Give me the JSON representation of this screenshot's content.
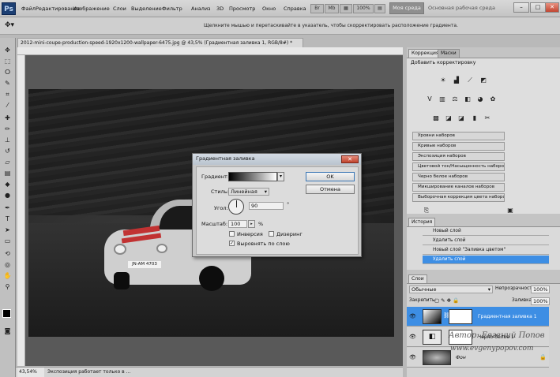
{
  "app": {
    "logo": "Ps"
  },
  "menu": [
    "Файл",
    "Редактирование",
    "Изображение",
    "Слои",
    "Выделение",
    "Фильтр",
    "Анализ",
    "3D",
    "Просмотр",
    "Окно",
    "Справка"
  ],
  "titlebar_controls": {
    "zoom": "100%",
    "workspace_active": "Моя среда",
    "workspace_other": "Основная рабочая среда"
  },
  "options_bar": {
    "hint": "Щелкните мышью и перетаскивайте в указатель, чтобы скорректировать расположение градиента."
  },
  "document": {
    "tab_title": "2012-mini-coupe-production-speed-1920x1200-wallpaper-6475.jpg @ 43,5% (Градиентная заливка 1, RGB/8#) *",
    "zoom": "43,54%",
    "status": "Экспозиция работает только в ...",
    "plate": "JN-AM 4703"
  },
  "dialog": {
    "title": "Градиентная заливка",
    "gradient_label": "Градиент:",
    "style_label": "Стиль:",
    "style_value": "Линейная",
    "angle_label": "Угол:",
    "angle_value": "90",
    "angle_unit": "°",
    "scale_label": "Масштаб:",
    "scale_value": "100",
    "scale_unit": "%",
    "reverse_label": "Инверсия",
    "dither_label": "Дизеринг",
    "align_label": "Выровнять по слою",
    "reverse_checked": false,
    "dither_checked": false,
    "align_checked": true,
    "ok": "OK",
    "cancel": "Отмена"
  },
  "adjustments": {
    "tabs": [
      "Коррекция",
      "Маски"
    ],
    "header": "Добавить корректировку",
    "presets": [
      "Уровни наборов",
      "Кривые наборов",
      "Экспозиция наборов",
      "Цветовой тон/Насыщенность наборов",
      "Черно белое наборов",
      "Микширование каналов наборов",
      "Выборочная коррекция цвета наборов"
    ]
  },
  "history": {
    "tab": "История",
    "items": [
      "Новый слой",
      "Удалить слой",
      "Новый слой \"Заливка цветом\"",
      "Удалить слой"
    ]
  },
  "layers": {
    "tab": "Слои",
    "blend_mode": "Обычные",
    "opacity_label": "Непрозрачность:",
    "opacity_value": "100%",
    "lock_label": "Закрепить:",
    "fill_label": "Заливка:",
    "fill_value": "100%",
    "rows": [
      {
        "name": "Градиентная заливка 1",
        "selected": true
      },
      {
        "name": "Черно-белое 1",
        "selected": false
      },
      {
        "name": "Фон",
        "selected": false
      }
    ]
  },
  "watermark": {
    "author": "Автор: Евгений Попов",
    "site": "www.evgenypopov.com"
  },
  "colors": {
    "accent": "#3d8ee4",
    "selected_row": "#3d8ee4",
    "dialog_bg": "#dcdcdc"
  }
}
